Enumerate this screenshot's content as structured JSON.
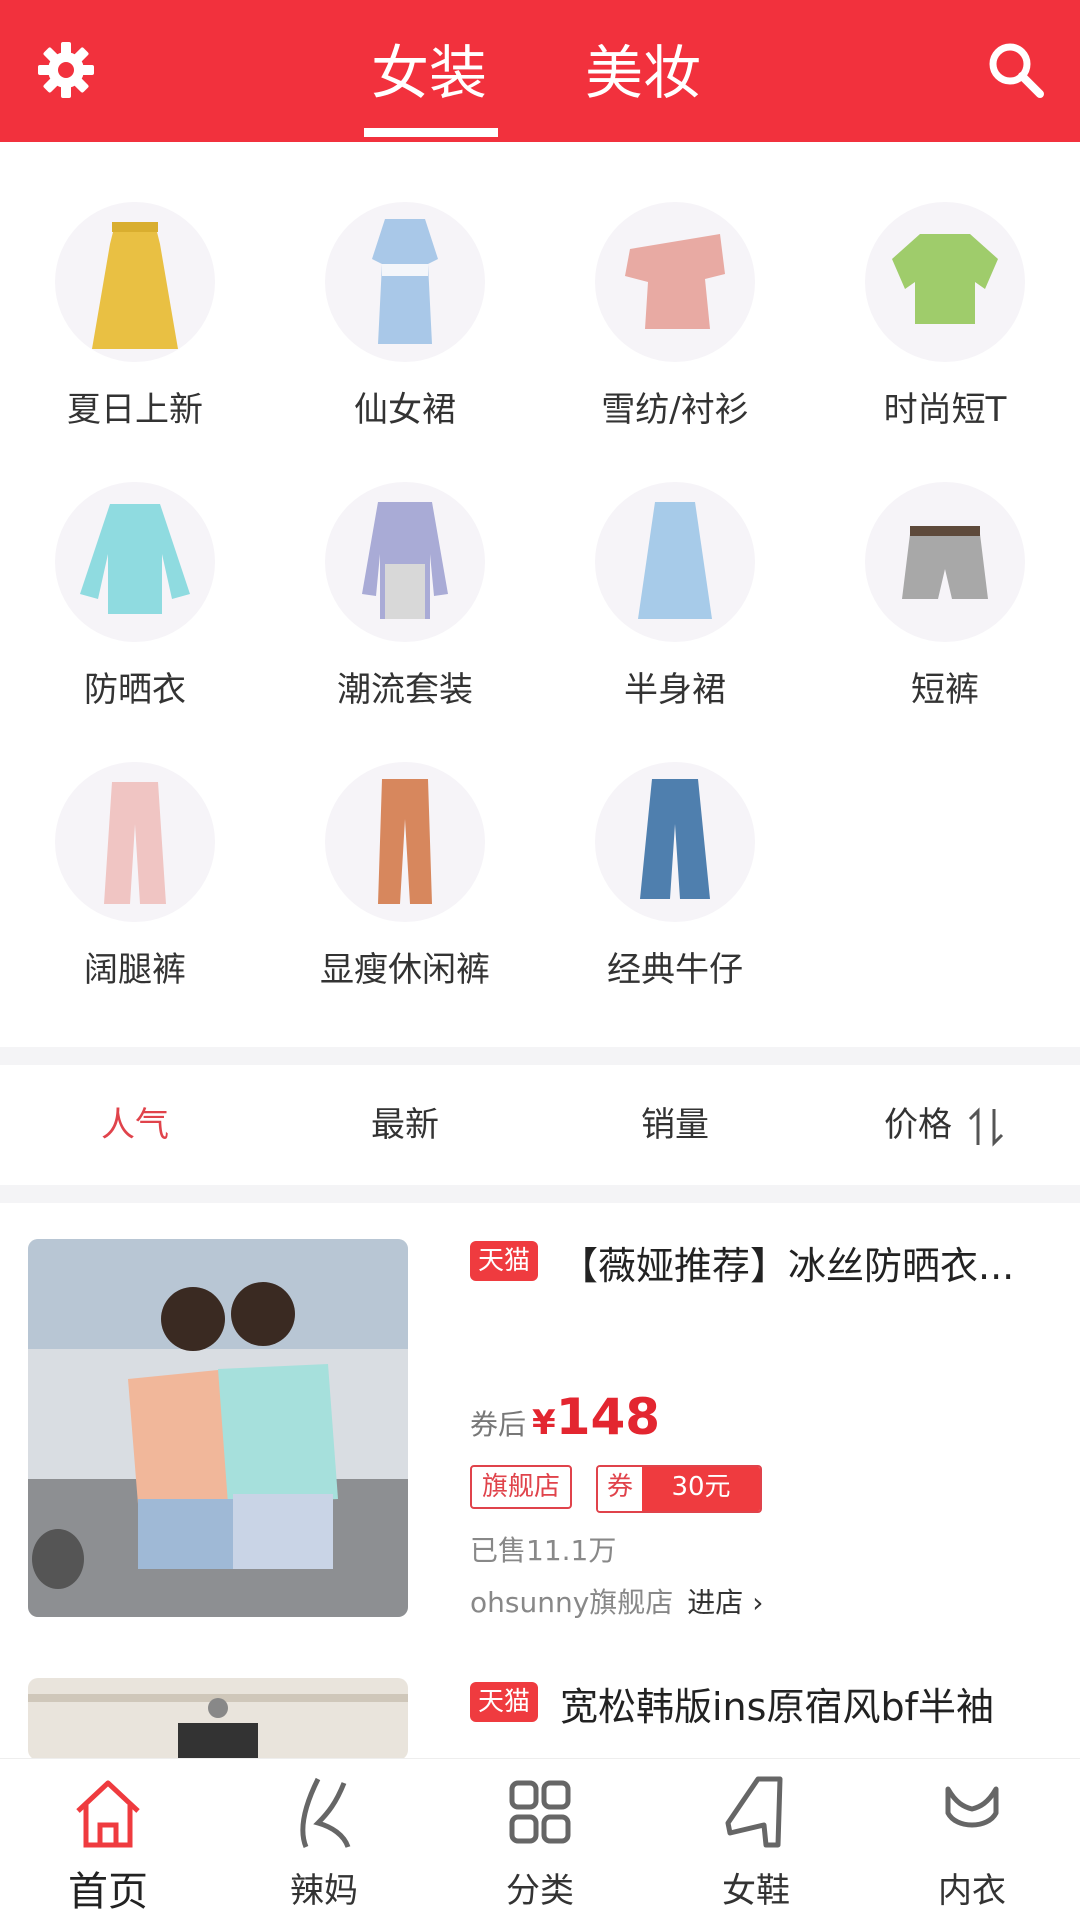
{
  "header": {
    "tabs": [
      {
        "label": "女装",
        "active": true
      },
      {
        "label": "美妆",
        "active": false
      }
    ],
    "settings_icon": "gear-icon",
    "search_icon": "search-icon",
    "bg_color": "#f2313d"
  },
  "categories": [
    {
      "label": "夏日上新",
      "icon": "yellow-dress"
    },
    {
      "label": "仙女裙",
      "icon": "blue-dress"
    },
    {
      "label": "雪纺/衬衫",
      "icon": "pink-ruffle-top"
    },
    {
      "label": "时尚短T",
      "icon": "green-blouse"
    },
    {
      "label": "防晒衣",
      "icon": "blue-shirt"
    },
    {
      "label": "潮流套装",
      "icon": "plaid-set"
    },
    {
      "label": "半身裙",
      "icon": "tulle-skirt"
    },
    {
      "label": "短裤",
      "icon": "grey-shorts"
    },
    {
      "label": "阔腿裤",
      "icon": "pink-trousers"
    },
    {
      "label": "显瘦休闲裤",
      "icon": "orange-trousers"
    },
    {
      "label": "经典牛仔",
      "icon": "flare-jeans"
    }
  ],
  "sort": {
    "items": [
      "人气",
      "最新",
      "销量",
      "价格"
    ],
    "active": "人气",
    "price_sort_icon": "sort-arrows-icon"
  },
  "products": [
    {
      "platform_badge": "天猫",
      "title": "【薇娅推荐】冰丝防晒衣...",
      "price_prefix": "券后",
      "currency": "¥",
      "price": "148",
      "shop_tag": "旗舰店",
      "coupon_label": "券",
      "coupon_value": "30元",
      "sold": "已售11.1万",
      "shop_name": "ohsunny旗舰店",
      "enter_shop": "进店"
    },
    {
      "platform_badge": "天猫",
      "title": "宽松韩版ins原宿风bf半袖"
    }
  ],
  "bottom_nav": [
    {
      "label": "首页",
      "icon": "home-icon",
      "active": true
    },
    {
      "label": "辣妈",
      "icon": "maternity-icon",
      "active": false
    },
    {
      "label": "分类",
      "icon": "grid-icon",
      "active": false
    },
    {
      "label": "女鞋",
      "icon": "boot-icon",
      "active": false
    },
    {
      "label": "内衣",
      "icon": "bra-icon",
      "active": false
    }
  ],
  "colors": {
    "accent": "#f2313d",
    "price": "#e32630",
    "active_sort": "#e0434b"
  }
}
